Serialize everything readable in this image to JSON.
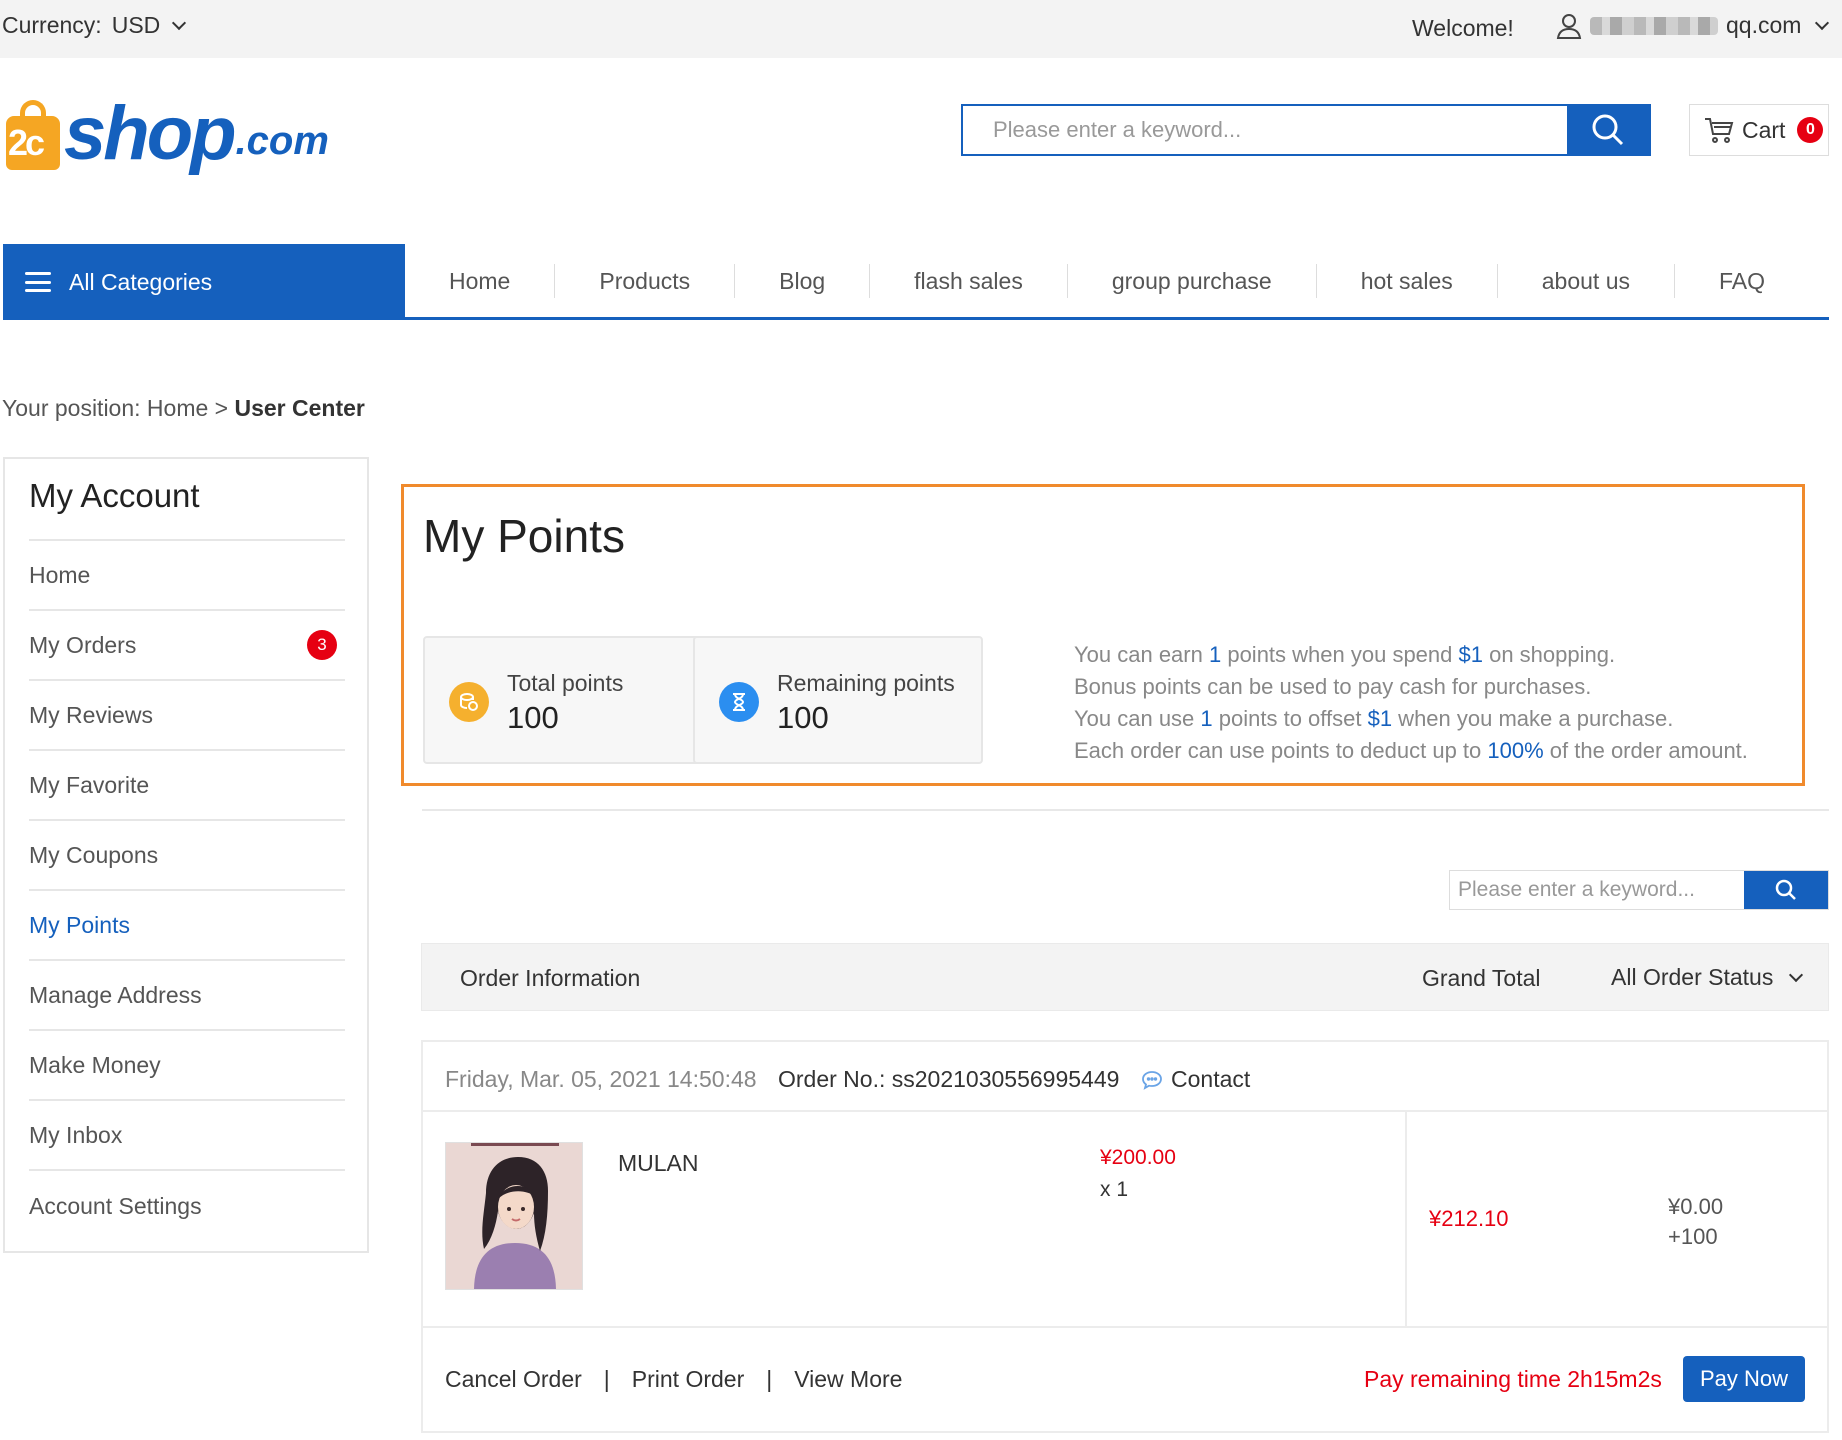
{
  "topbar": {
    "currency_label": "Currency:",
    "currency_value": "USD",
    "welcome": "Welcome!",
    "user_email_suffix": "qq.com"
  },
  "logo": {
    "prefix": "2c",
    "word": "shop",
    "suffix": ".com"
  },
  "header": {
    "search_placeholder": "Please enter a keyword...",
    "cart_label": "Cart",
    "cart_count": "0"
  },
  "nav": {
    "all_categories": "All Categories",
    "items": [
      "Home",
      "Products",
      "Blog",
      "flash sales",
      "group purchase",
      "hot sales",
      "about us",
      "FAQ"
    ]
  },
  "breadcrumb": {
    "prefix": "Your position: Home >",
    "current": "User Center"
  },
  "sidebar": {
    "title": "My Account",
    "items": [
      {
        "label": "Home"
      },
      {
        "label": "My Orders",
        "badge": "3"
      },
      {
        "label": "My Reviews"
      },
      {
        "label": "My Favorite"
      },
      {
        "label": "My Coupons"
      },
      {
        "label": "My Points"
      },
      {
        "label": "Manage Address"
      },
      {
        "label": "Make Money"
      },
      {
        "label": "My Inbox"
      },
      {
        "label": "Account Settings"
      }
    ]
  },
  "points": {
    "title": "My Points",
    "total_label": "Total points",
    "total_value": "100",
    "remaining_label": "Remaining points",
    "remaining_value": "100",
    "info": {
      "l1a": "You can earn ",
      "l1b": "1",
      "l1c": " points when you spend ",
      "l1d": "$1",
      "l1e": " on shopping.",
      "l2": "Bonus points can be used to pay cash for purchases.",
      "l3a": "You can use ",
      "l3b": "1",
      "l3c": " points to offset ",
      "l3d": "$1",
      "l3e": " when you make a purchase.",
      "l4a": "Each order can use points to deduct up to ",
      "l4b": "100%",
      "l4c": " of the order amount."
    }
  },
  "order_search": {
    "placeholder": "Please enter a keyword..."
  },
  "order_table": {
    "col_info": "Order Information",
    "col_total": "Grand Total",
    "col_status": "All Order Status"
  },
  "order": {
    "date": "Friday, Mar. 05, 2021 14:50:48",
    "order_no": "Order No.: ss2021030556995449",
    "contact": "Contact",
    "product_name": "MULAN",
    "price": "¥200.00",
    "qty": "x 1",
    "grand_total": "¥212.10",
    "points_amount": "¥0.00",
    "points_delta": "+100",
    "cancel": "Cancel Order",
    "print": "Print Order",
    "view_more": "View More",
    "separator": "|",
    "remaining_time": "Pay remaining time 2h15m2s",
    "pay_now": "Pay Now"
  },
  "colors": {
    "brand_blue": "#1560bd",
    "highlight_orange": "#f08a2c",
    "alert_red": "#e60012"
  }
}
